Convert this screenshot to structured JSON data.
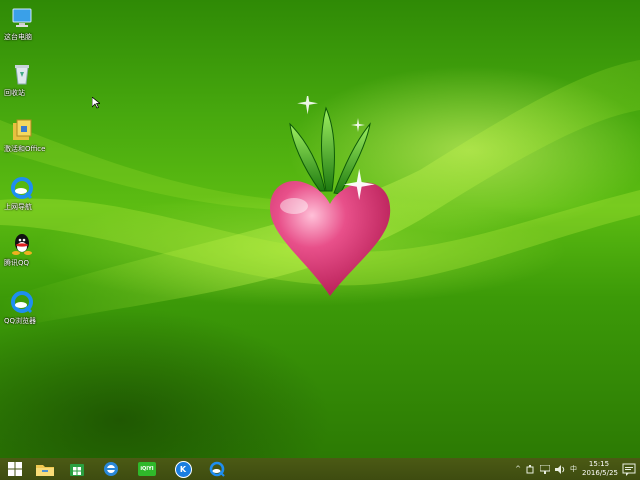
{
  "desktop": {
    "icons": [
      {
        "label": "这台电脑",
        "icon": "computer-icon"
      },
      {
        "label": "回收站",
        "icon": "recycle-bin-icon"
      },
      {
        "label": "激活和Office",
        "icon": "office-activation-icon"
      },
      {
        "label": "上网导航",
        "icon": "browser-nav-icon"
      },
      {
        "label": "腾讯QQ",
        "icon": "qq-icon"
      },
      {
        "label": "QQ浏览器",
        "icon": "qq-browser-icon"
      }
    ]
  },
  "taskbar": {
    "start": "windows-start-icon",
    "pinned": [
      "file-explorer-icon",
      "store-icon",
      "ie-icon",
      "iqiyi-icon",
      "kugou-icon",
      "qq-browser-icon"
    ],
    "pinned_labels": {
      "iqiyi": "iQIYI",
      "kugou": "K"
    },
    "tray": {
      "chevron": "^",
      "ime": "中"
    },
    "clock": {
      "time": "15:15",
      "date": "2016/5/25"
    }
  },
  "colors": {
    "accent_green": "#5cbc12",
    "radish_pink": "#e0407a",
    "taskbar": "#44521a"
  }
}
